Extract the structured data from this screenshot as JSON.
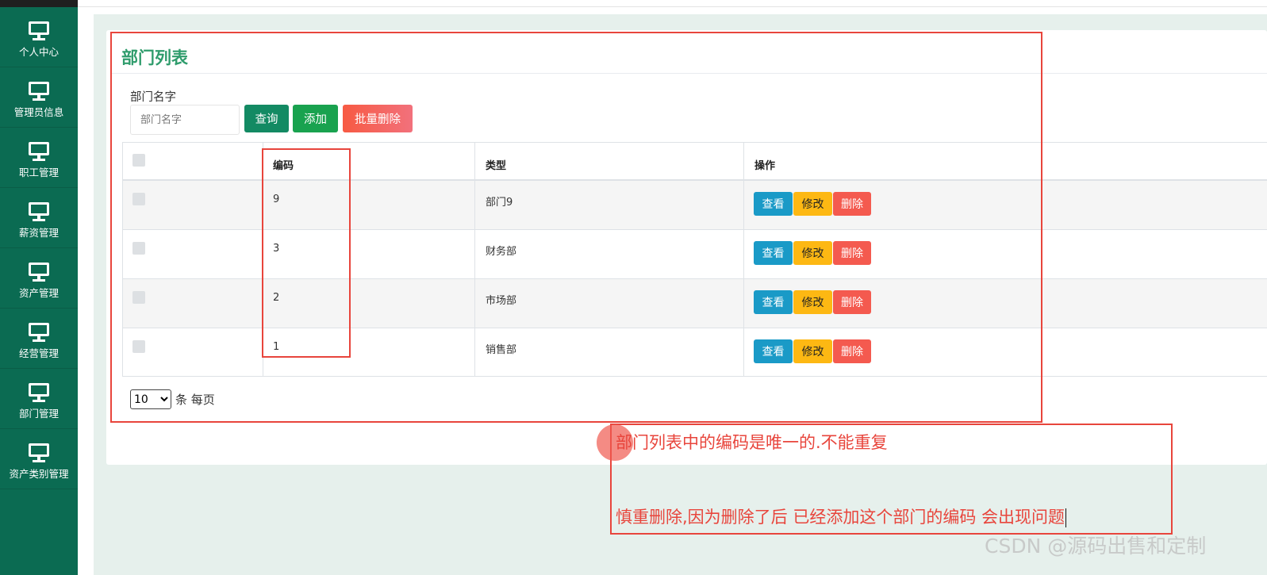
{
  "sidebar": {
    "items": [
      {
        "label": "个人中心",
        "icon": "monitor-icon"
      },
      {
        "label": "管理员信息",
        "icon": "monitor-icon"
      },
      {
        "label": "职工管理",
        "icon": "monitor-icon"
      },
      {
        "label": "薪资管理",
        "icon": "monitor-icon"
      },
      {
        "label": "资产管理",
        "icon": "monitor-icon"
      },
      {
        "label": "经营管理",
        "icon": "monitor-icon"
      },
      {
        "label": "部门管理",
        "icon": "monitor-icon"
      },
      {
        "label": "资产类别管理",
        "icon": "monitor-icon"
      }
    ]
  },
  "main": {
    "title": "部门列表",
    "search": {
      "label": "部门名字",
      "placeholder": "部门名字",
      "value": ""
    },
    "buttons": {
      "query": "查询",
      "add": "添加",
      "batch_delete": "批量删除"
    },
    "table": {
      "columns": [
        "编码",
        "类型",
        "操作"
      ],
      "rows": [
        {
          "code": "9",
          "type": "部门9"
        },
        {
          "code": "3",
          "type": "财务部"
        },
        {
          "code": "2",
          "type": "市场部"
        },
        {
          "code": "1",
          "type": "销售部"
        }
      ],
      "actions": {
        "view": "查看",
        "edit": "修改",
        "delete": "删除"
      }
    },
    "pagination": {
      "page_size": "10",
      "suffix": "条 每页"
    }
  },
  "annotations": {
    "note1": "部门列表中的编码是唯一的.不能重复",
    "note2": "慎重删除,因为删除了后  已经添加这个部门的编码 会出现问题"
  },
  "watermark": "CSDN @源码出售和定制",
  "colors": {
    "sidebar": "#0b6b52",
    "title": "#2f9c6c",
    "annotation": "#e8453c",
    "view_button": "#1a9ac7",
    "edit_button": "#fdb813",
    "delete_button": "#f45a4f"
  }
}
